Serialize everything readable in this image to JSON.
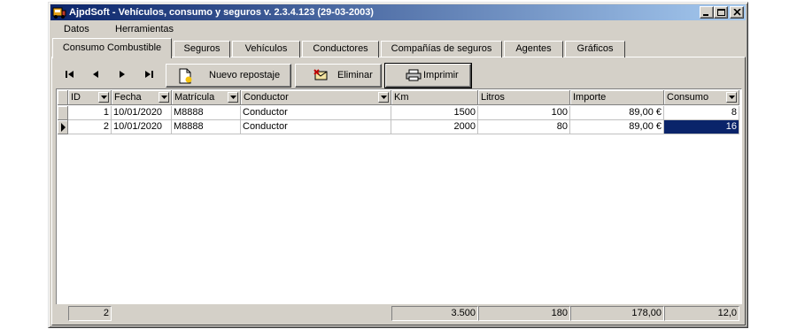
{
  "window": {
    "title": "AjpdSoft - Vehículos, consumo y  seguros v. 2.3.4.123 (29-03-2003)"
  },
  "menu": [
    "Datos",
    "Herramientas"
  ],
  "tabs": [
    "Consumo Combustible",
    "Seguros",
    "Vehículos",
    "Conductores",
    "Compañías de seguros",
    "Agentes",
    "Gráficos"
  ],
  "active_tab": "Consumo Combustible",
  "toolbar": {
    "nav_icons": [
      "first-record-icon",
      "prior-record-icon",
      "next-record-icon",
      "last-record-icon"
    ],
    "new_label": "Nuevo repostaje",
    "delete_label": "Eliminar",
    "print_label": "Imprimir"
  },
  "grid": {
    "columns": [
      "ID",
      "Fecha",
      "Matrícula",
      "Conductor",
      "Km",
      "Litros",
      "Importe",
      "Consumo"
    ],
    "rows": [
      [
        "1",
        "10/01/2020",
        "M8888",
        "Conductor",
        "1500",
        "100",
        "89,00 €",
        "8"
      ],
      [
        "2",
        "10/01/2020",
        "M8888",
        "Conductor",
        "2000",
        "80",
        "89,00 €",
        "16"
      ]
    ],
    "totals": [
      "2",
      "3.500",
      "180",
      "178,00",
      "12,0"
    ]
  },
  "colors": {
    "title_start": "#0a246a",
    "title_end": "#a6caf0",
    "selection": "#0a246a",
    "face": "#d4d0c8"
  }
}
